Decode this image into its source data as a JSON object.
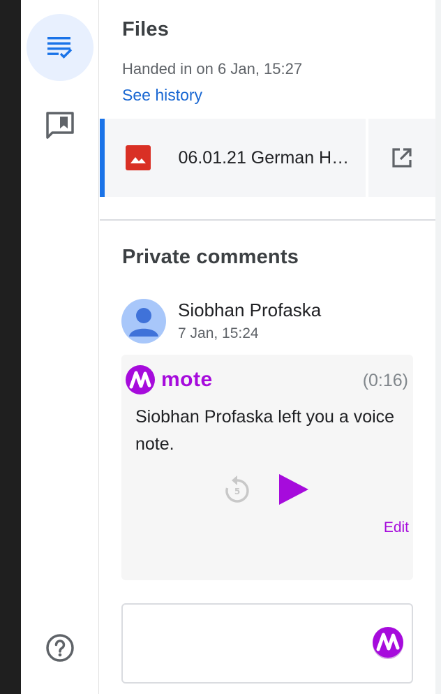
{
  "rail": {
    "items": [
      {
        "icon": "assignment-list-icon",
        "active": true
      },
      {
        "icon": "feedback-comment-icon",
        "active": false
      },
      {
        "icon": "help-icon",
        "active": false
      }
    ]
  },
  "files": {
    "title": "Files",
    "handed_in": "Handed in on 6 Jan, 15:27",
    "see_history": "See history",
    "attachment": {
      "name": "06.01.21 German H…",
      "icon": "image-file-icon",
      "action_icon": "open-in-new-icon"
    }
  },
  "private_comments": {
    "title": "Private comments",
    "comment": {
      "author": "Siobhan Profaska",
      "time": "7 Jan, 15:24",
      "mote": {
        "brand": "mote",
        "duration": "(0:16)",
        "message": "Siobhan Profaska left you a voice note.",
        "replay_icon": "replay-5-icon",
        "play_icon": "play-icon",
        "edit_label": "Edit"
      }
    },
    "input": {
      "value": "",
      "placeholder": "",
      "mote_icon": "mote-logo-icon"
    }
  },
  "colors": {
    "accent_blue": "#1a73e8",
    "link_blue": "#1967d2",
    "mote_purple": "#a60bdc",
    "file_red": "#d93025"
  }
}
